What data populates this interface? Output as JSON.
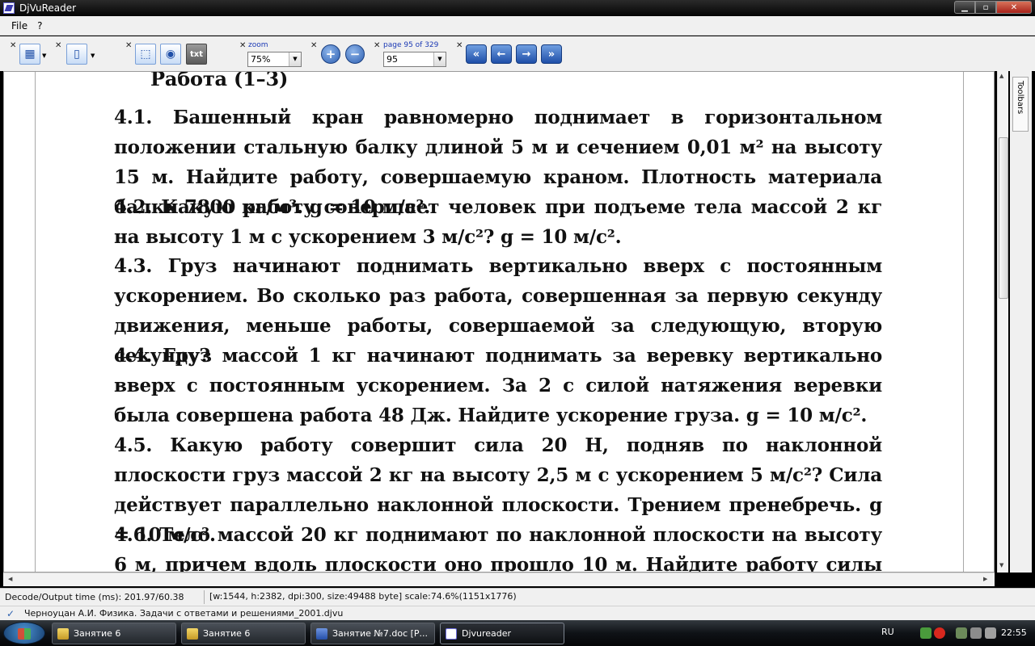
{
  "window": {
    "title": "DjVuReader"
  },
  "menu": {
    "items": [
      "File",
      "?"
    ]
  },
  "toolbar": {
    "zoom_label": "zoom",
    "zoom_value": "75%",
    "page_label": "page 95 of 329",
    "page_value": "95",
    "txt_label": "txt"
  },
  "document": {
    "heading": "Работа (1–3)",
    "paragraphs": [
      "4.1. Башенный кран равномерно поднимает в горизонтальном положении стальную балку длиной 5 м и сечением 0,01 м² на высоту 15 м. Найдите работу, совершаемую краном. Плотность материала балки 7800 кг/м³. g = 10 м/с².",
      "4.2. Какую работу совершает человек при подъеме тела массой 2 кг на высоту 1 м с ускорением 3 м/с²? g = 10 м/с².",
      "4.3. Груз начинают поднимать вертикально вверх с постоянным ускорением. Во сколько раз работа, совершенная за первую секунду движения, меньше работы, совершаемой за следующую, вторую секунду?",
      "4.4. Груз массой 1 кг начинают поднимать за веревку вертикально вверх с постоянным ускорением. За 2 с силой натяжения веревки была совершена работа 48 Дж. Найдите ускорение груза. g = 10 м/с².",
      "4.5. Какую работу совершит сила 20 Н, подняв по наклонной плоскости груз массой 2 кг на высоту 2,5 м с ускорением 5 м/с²? Сила действует параллельно наклонной плоскости. Трением пренебречь. g = 10 м/с².",
      "4.6. Тело массой 20 кг поднимают по наклонной плоскости на высоту 6 м, причем вдоль плоскости оно прошло 10 м. Найдите работу силы трения, если"
    ]
  },
  "side": {
    "toolbars_label": "Toolbars"
  },
  "status": {
    "timing": "Decode/Output time (ms): 201.97/60.38",
    "info": "[w:1544, h:2382, dpi:300, size:49488 byte] scale:74.6%(1151x1776)",
    "file": "Черноуцан А.И. Физика. Задачи с ответами и решениями_2001.djvu"
  },
  "taskbar": {
    "tasks": [
      "Занятие 6",
      "Занятие 6",
      "Занятие №7.doc [Р...",
      "Djvureader"
    ],
    "lang": "RU",
    "clock": "22:55"
  }
}
